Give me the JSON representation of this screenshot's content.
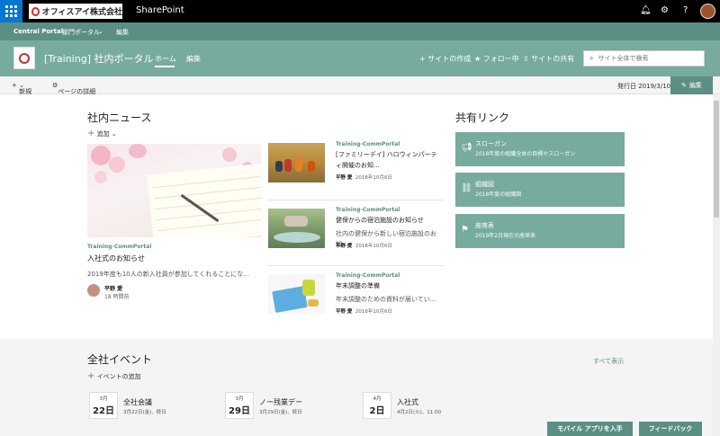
{
  "suite_bar": {
    "company": "オフィスアイ株式会社",
    "app_name": "SharePoint",
    "icons": [
      "waffle-icon",
      "bell-icon",
      "gear-icon",
      "help-icon"
    ]
  },
  "hub_nav": {
    "items": [
      "Central Portal",
      "部門ポータル",
      "編集"
    ]
  },
  "site_header": {
    "title": "[Training] 社内ポータル",
    "nav": {
      "home": "ホーム",
      "edit": "編集"
    },
    "actions": {
      "create_site": "サイトの作成",
      "follow": "フォロー中",
      "share": "サイトの共有"
    },
    "search_placeholder": "サイト全体で検索"
  },
  "command_bar": {
    "new": "新規",
    "page_details": "ページの詳細",
    "published": "発行日 2019/3/10",
    "edit": "編集"
  },
  "news": {
    "heading": "社内ニュース",
    "add": "追加",
    "hero": {
      "site": "Training-CommPortal",
      "title": "入社式のお知らせ",
      "description": "2019年度も10人の新入社員が参加してくれることにな...",
      "author": "平野 愛",
      "time": "18 時間前"
    },
    "items": [
      {
        "site": "Training-CommPortal",
        "title": "[ファミリーデイ] ハロウィンパーティ開催のお知...",
        "author": "平野 愛",
        "date": "2018年10月6日"
      },
      {
        "site": "Training-CommPortal",
        "title": "健保からの宿泊施設のお知らせ",
        "description": "社内の健保から新しい宿泊施設のお知...",
        "author": "平野 愛",
        "date": "2018年10月6日"
      },
      {
        "site": "Training-CommPortal",
        "title": "年末調整の準備",
        "description": "年末調整のための資料が届いてい...",
        "author": "平野 愛",
        "date": "2018年10月6日"
      }
    ]
  },
  "quick_links": {
    "heading": "共有リンク",
    "items": [
      {
        "title": "スローガン",
        "desc": "2018年度の組織全体の目標やスローガン",
        "icon": "megaphone-icon"
      },
      {
        "title": "組織図",
        "desc": "2018年度の組織図",
        "icon": "org-chart-icon"
      },
      {
        "title": "座席表",
        "desc": "2019年2月現在の座席表",
        "icon": "seat-icon"
      }
    ]
  },
  "events": {
    "heading": "全社イベント",
    "see_all": "すべて表示",
    "add": "イベントの追加",
    "items": [
      {
        "month": "3月",
        "day": "22日",
        "title": "全社会議",
        "sub": "3月22日(金)、終日"
      },
      {
        "month": "3月",
        "day": "29日",
        "title": "ノー残業デー",
        "sub": "3月29日(金)、終日"
      },
      {
        "month": "4月",
        "day": "2日",
        "title": "入社式",
        "sub": "4月2日(火)、11:00"
      }
    ]
  },
  "footer": {
    "mobile_app": "モバイル アプリを入手",
    "feedback": "フィードバック"
  },
  "colors": {
    "theme": "#76ab9d",
    "theme_dark": "#5c8f83",
    "suite": "#000000",
    "waffle": "#0078d4"
  }
}
